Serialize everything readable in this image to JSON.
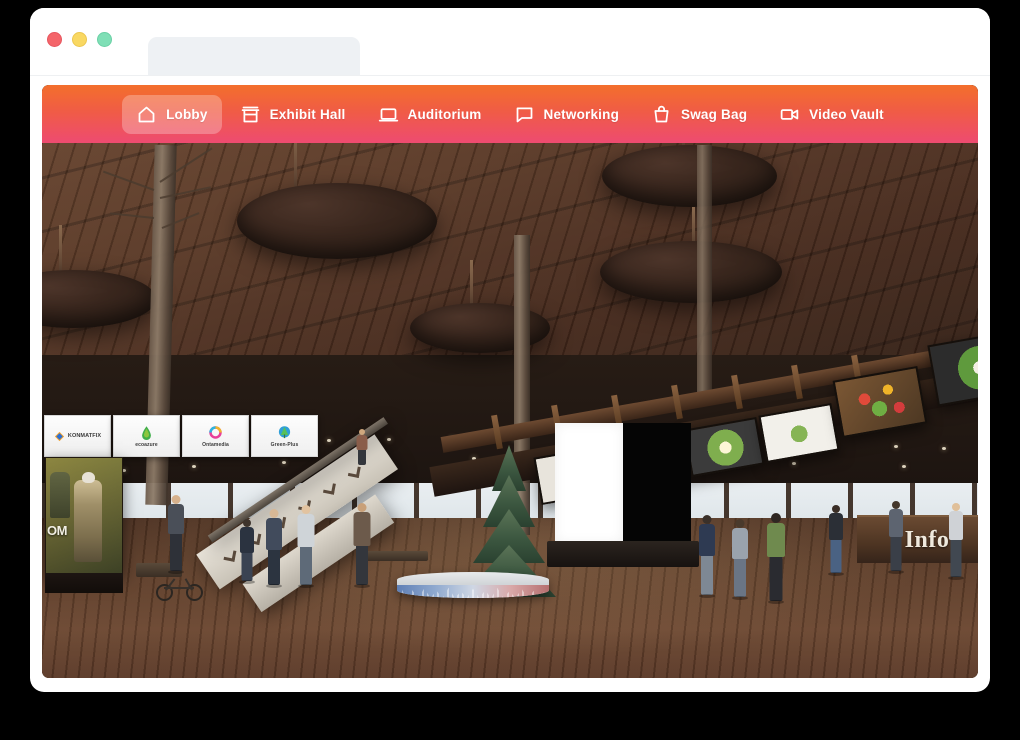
{
  "window": {
    "traffic_lights": [
      {
        "name": "close",
        "color": "#f4656a"
      },
      {
        "name": "minimize",
        "color": "#f9d862"
      },
      {
        "name": "maximize",
        "color": "#7fdfb6"
      }
    ],
    "tab": {
      "title": ""
    }
  },
  "nav": {
    "background_gradient": {
      "from": "#f36f2c",
      "to": "#ee4b71"
    },
    "active_item": "Lobby",
    "items": [
      {
        "label": "Lobby",
        "icon": "home-icon",
        "active": true
      },
      {
        "label": "Exhibit Hall",
        "icon": "store-icon",
        "active": false
      },
      {
        "label": "Auditorium",
        "icon": "laptop-icon",
        "active": false
      },
      {
        "label": "Networking",
        "icon": "chat-bubble-icon",
        "active": false
      },
      {
        "label": "Swag Bag",
        "icon": "shopping-bag-icon",
        "active": false
      },
      {
        "label": "Video Vault",
        "icon": "video-camera-icon",
        "active": false
      }
    ]
  },
  "scene": {
    "name": "virtual-event-lobby",
    "info_desk_label": "Info",
    "poster": {
      "text": "OM",
      "theme": "camouflage"
    },
    "sponsors": [
      {
        "name": "KONMATFIX",
        "layout": "inline",
        "mark": "diamond",
        "colors": [
          "#f0a030",
          "#2a6fd4"
        ]
      },
      {
        "name": "ecoazure",
        "layout": "stacked",
        "mark": "leaf",
        "colors": [
          "#3fae4a",
          "#8cc63e"
        ]
      },
      {
        "name": "Ontamedia",
        "layout": "stacked",
        "mark": "ring",
        "colors": [
          "#e8409a",
          "#2bb6e0"
        ]
      },
      {
        "name": "Green-Plus",
        "layout": "stacked",
        "mark": "tree",
        "colors": [
          "#2f9fd8",
          "#57c15a"
        ]
      }
    ],
    "food_screens": [
      {
        "dish": "avocado-toast-egg"
      },
      {
        "dish": "grilled-chicken-salad"
      },
      {
        "dish": "avocado-toast-poached-egg"
      },
      {
        "dish": "green-salad-plate"
      },
      {
        "dish": "vegetable-platter"
      },
      {
        "dish": "salad-bowl-egg"
      }
    ],
    "kiosk": {
      "left_panel": "#ffffff",
      "right_panel": "#050505"
    },
    "tree": {
      "type": "christmas-tree",
      "stage": "mountain-band-platform"
    }
  }
}
